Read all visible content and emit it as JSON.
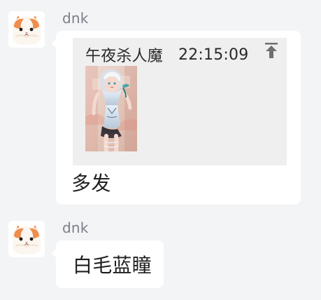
{
  "messages": [
    {
      "sender": "dnk",
      "reply": {
        "author": "午夜杀人魔",
        "time": "22:15:09",
        "jump_icon": "jump-to-top-icon",
        "image": "anime-girl-thumbnail"
      },
      "text": "多发",
      "avatar": "cat-avatar"
    },
    {
      "sender": "dnk",
      "text": "白毛蓝瞳",
      "avatar": "cat-avatar"
    }
  ],
  "colors": {
    "background": "#f3f4f6",
    "bubble": "#ffffff",
    "reply": "#efefef",
    "name": "#7b7f86",
    "text": "#1f1f1f",
    "icon": "#6d6f73"
  }
}
